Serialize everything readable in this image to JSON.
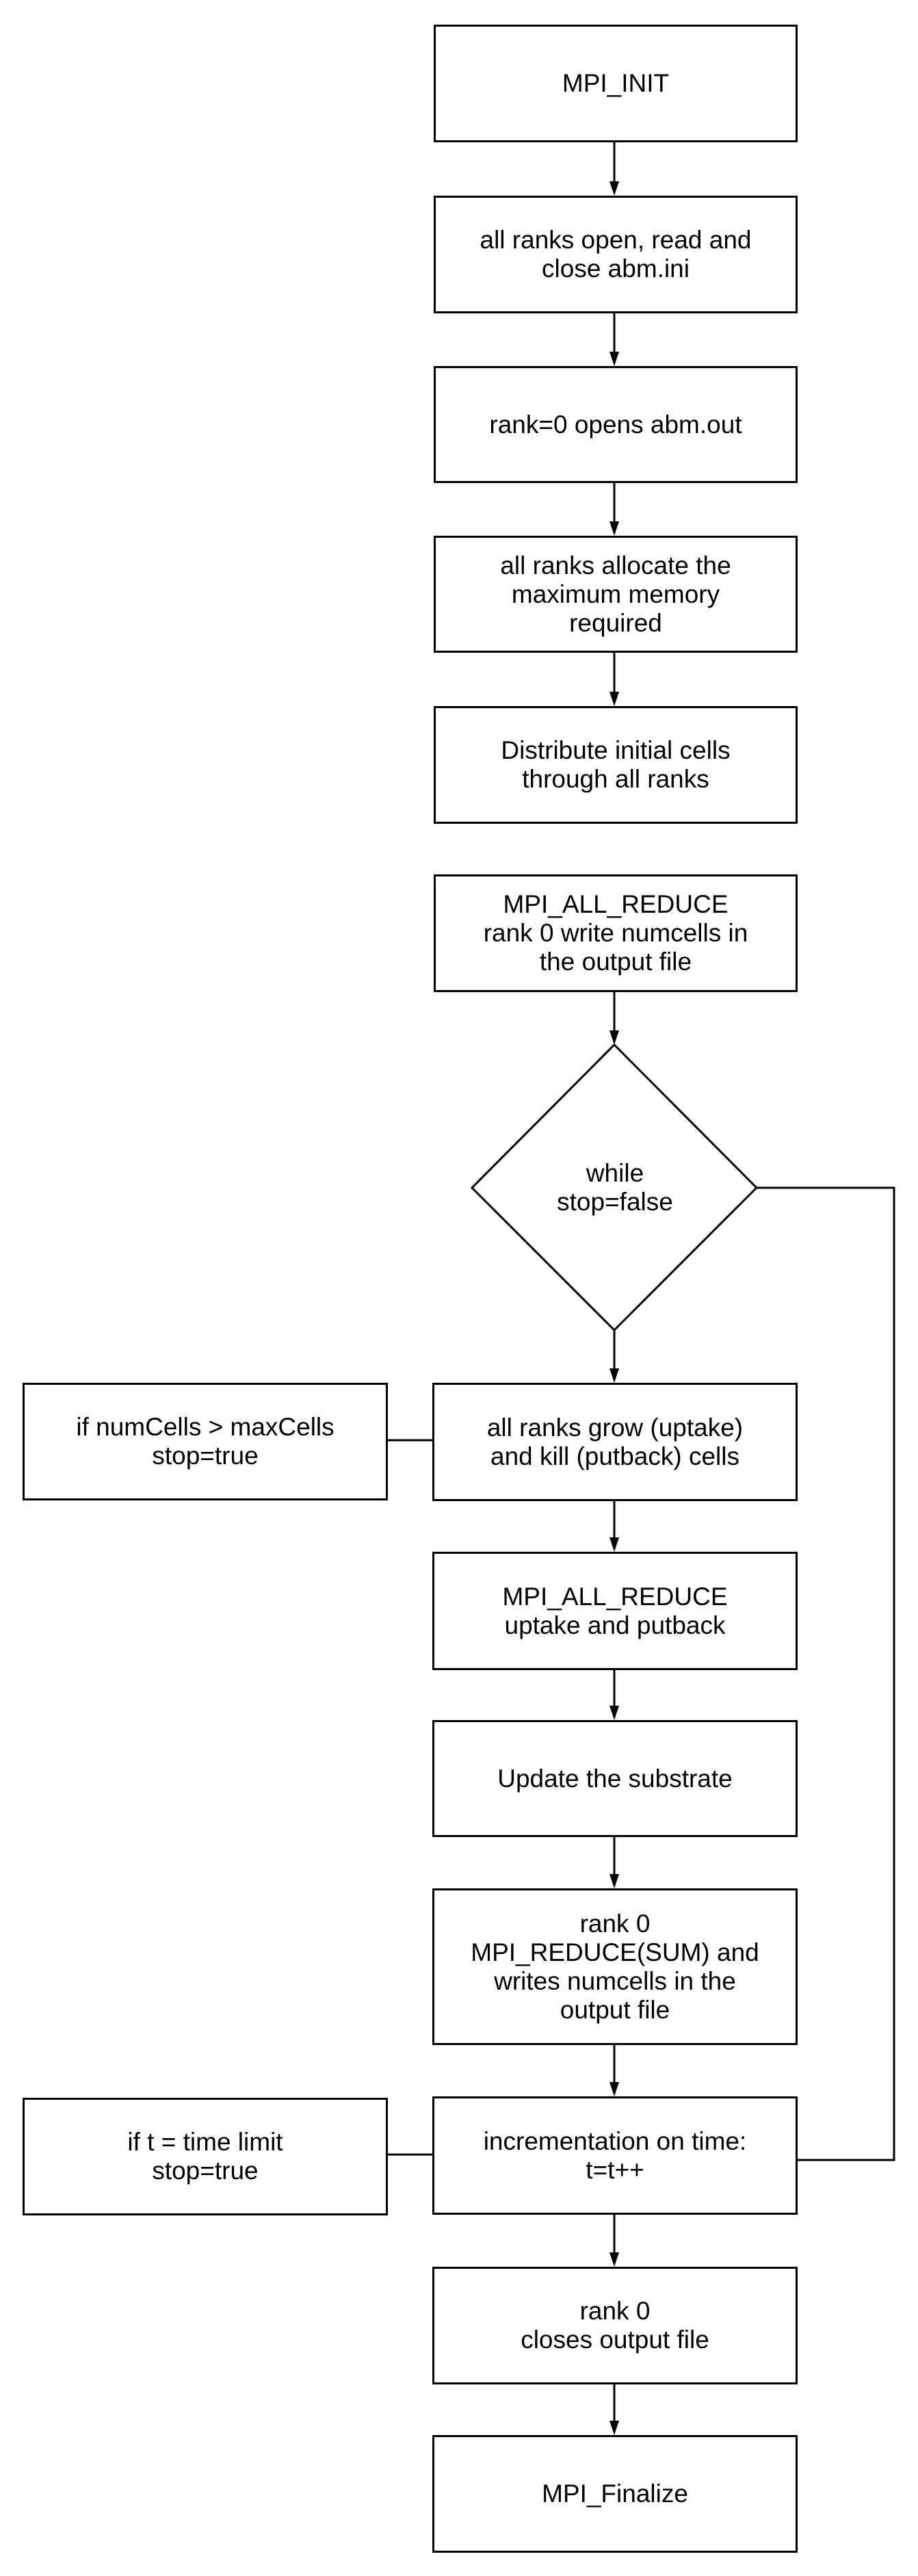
{
  "diagram": {
    "type": "flowchart",
    "nodes": {
      "mpi_init": "MPI_INIT",
      "read_ini": "all ranks open, read and\nclose abm.ini",
      "open_out": "rank=0 opens abm.out",
      "allocate": "all ranks allocate the\nmaximum memory\nrequired",
      "distribute": "Distribute initial cells\nthrough all ranks",
      "all_reduce_init": "MPI_ALL_REDUCE\nrank 0 write numcells in\nthe output file",
      "while_cond": "while\nstop=false",
      "grow_kill": "all ranks grow (uptake)\nand kill (putback) cells",
      "max_cells_check": "if numCells > maxCells\nstop=true",
      "all_reduce_loop": "MPI_ALL_REDUCE\nuptake and putback",
      "update_substrate": "Update the substrate",
      "reduce_sum": "rank 0\nMPI_REDUCE(SUM) and\nwrites numcells in the\noutput file",
      "increment_time": "incrementation on time:\nt=t++",
      "time_limit_check": "if t = time limit\nstop=true",
      "close_output": "rank 0\ncloses output file",
      "finalize": "MPI_Finalize"
    },
    "edges": [
      {
        "from": "mpi_init",
        "to": "read_ini",
        "arrow": true
      },
      {
        "from": "read_ini",
        "to": "open_out",
        "arrow": true
      },
      {
        "from": "open_out",
        "to": "allocate",
        "arrow": true
      },
      {
        "from": "allocate",
        "to": "distribute",
        "arrow": true
      },
      {
        "from": "all_reduce_init",
        "to": "while_cond",
        "arrow": true
      },
      {
        "from": "while_cond",
        "to": "grow_kill",
        "arrow": true
      },
      {
        "from": "max_cells_check",
        "to": "grow_kill",
        "arrow": false
      },
      {
        "from": "grow_kill",
        "to": "all_reduce_loop",
        "arrow": true
      },
      {
        "from": "all_reduce_loop",
        "to": "update_substrate",
        "arrow": true
      },
      {
        "from": "update_substrate",
        "to": "reduce_sum",
        "arrow": true
      },
      {
        "from": "reduce_sum",
        "to": "increment_time",
        "arrow": true
      },
      {
        "from": "time_limit_check",
        "to": "increment_time",
        "arrow": false
      },
      {
        "from": "increment_time",
        "to": "while_cond",
        "arrow": false,
        "route": "loop-right"
      },
      {
        "from": "increment_time",
        "to": "close_output",
        "arrow": true
      },
      {
        "from": "close_output",
        "to": "finalize",
        "arrow": true
      }
    ],
    "colors": {
      "stroke": "#000000",
      "fill": "#ffffff",
      "text": "#000000"
    }
  }
}
